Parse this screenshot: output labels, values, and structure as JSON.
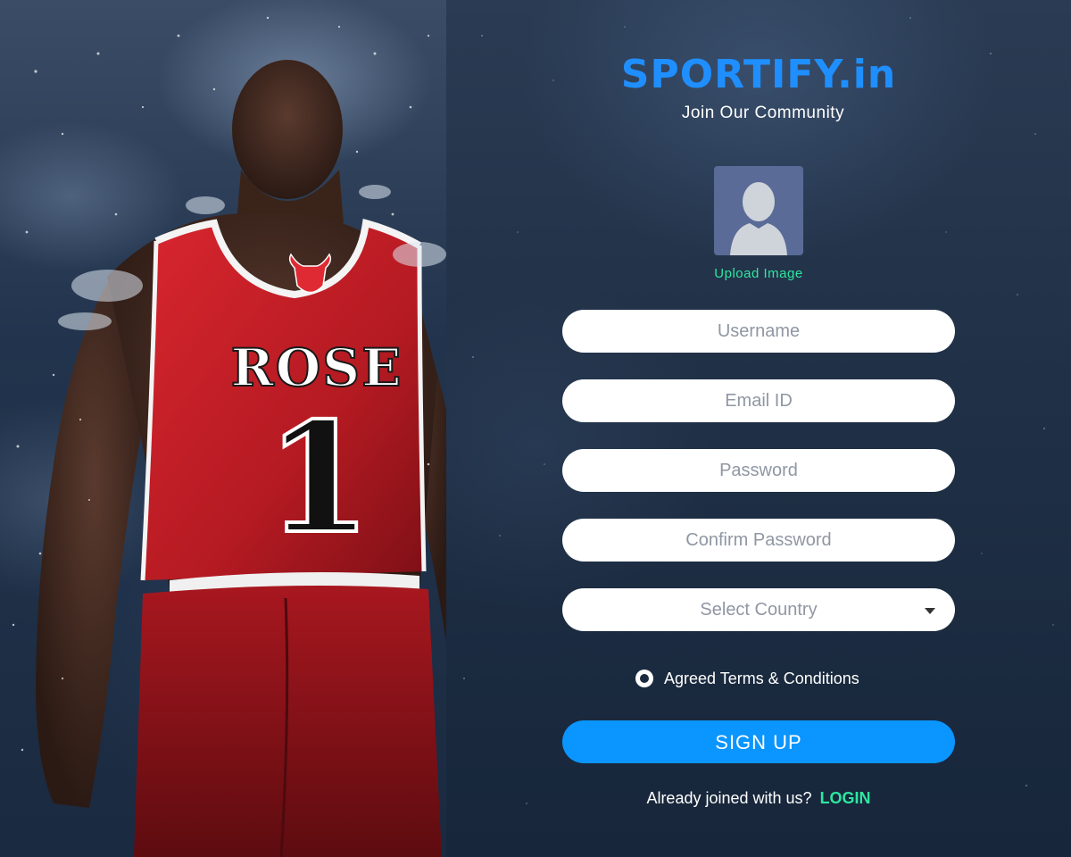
{
  "brand": {
    "name": "SPORTIFY",
    "tld": ".in",
    "tagline": "Join Our Community"
  },
  "hero": {
    "jersey_name": "ROSE",
    "jersey_number": "1"
  },
  "upload": {
    "label": "Upload Image"
  },
  "form": {
    "username_placeholder": "Username",
    "email_placeholder": "Email ID",
    "password_placeholder": "Password",
    "confirm_password_placeholder": "Confirm Password",
    "country_value": "Select Country",
    "terms_label": "Agreed Terms & Conditions",
    "terms_checked": true,
    "signup_label": "SIGN UP"
  },
  "footer": {
    "prompt": "Already joined with us?",
    "login_label": "LOGIN"
  },
  "colors": {
    "brand": "#1f8fff",
    "accent_green": "#2ee6a0",
    "signup_button": "#0a95ff",
    "jersey_red": "#c8202a"
  }
}
